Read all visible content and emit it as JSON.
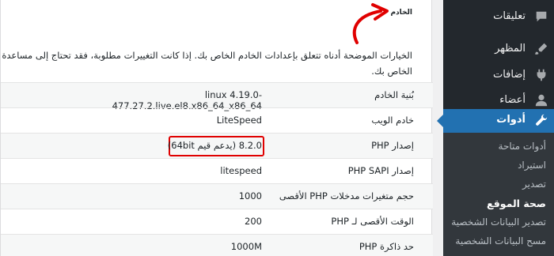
{
  "sidebar": {
    "items": [
      {
        "label": "تعليقات",
        "icon": "comments-icon"
      },
      {
        "label": "المظهر",
        "icon": "paintbrush-icon"
      },
      {
        "label": "إضافات",
        "icon": "plugins-icon"
      },
      {
        "label": "أعضاء",
        "icon": "users-icon"
      }
    ],
    "active": {
      "label": "أدوات",
      "icon": "wrench-icon"
    },
    "submenu": [
      "أدوات متاحة",
      "استيراد",
      "تصدير",
      "صحة الموقع",
      "تصدير البيانات الشخصية",
      "مسح البيانات الشخصية"
    ]
  },
  "section": {
    "title": "الخادم",
    "intro_line1": "الخيارات الموضحة أدناه تتعلق بإعدادات الخادم الخاص بك. إذا كانت التغييرات مطلوبة، فقد تحتاج إلى مساعدة مس",
    "intro_line2": "الخاص بك."
  },
  "rows": [
    {
      "key": "بُنية الخادم",
      "value": "linux 4.19.0-477.27.2.live.el8.x86_64_x86_64"
    },
    {
      "key": "خادم الويب",
      "value": "LiteSpeed"
    },
    {
      "key": "إصدار PHP",
      "value": "8.2.0 (يدعم قيم 64bit)"
    },
    {
      "key": "إصدار PHP SAPI",
      "value": "litespeed"
    },
    {
      "key": "حجم متغيرات مدخلات PHP الأقصى",
      "value": "1000"
    },
    {
      "key": "الوقت الأقصى لـ PHP",
      "value": "200"
    },
    {
      "key": "حد ذاكرة PHP",
      "value": "1000M"
    }
  ],
  "colors": {
    "accent": "#2271b1",
    "highlight": "#e00000",
    "sidebar": "#23282d"
  }
}
